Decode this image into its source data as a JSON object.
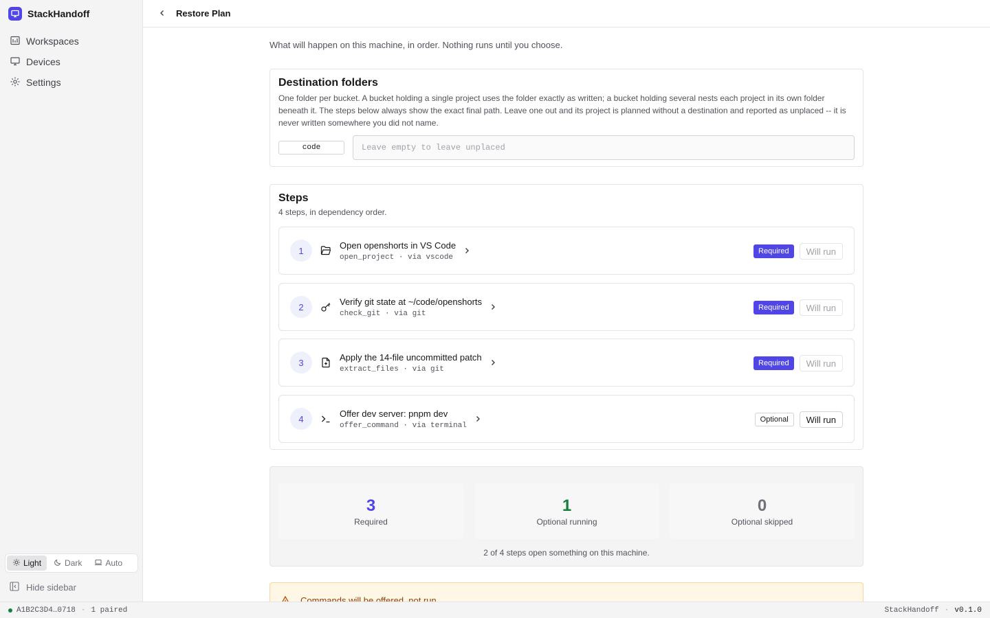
{
  "app": {
    "name": "StackHandoff",
    "version": "v0.1.0",
    "accent": "#4f46e5"
  },
  "sidebar": {
    "items": [
      {
        "label": "Workspaces",
        "icon": "workspaces-icon"
      },
      {
        "label": "Devices",
        "icon": "monitor-icon"
      },
      {
        "label": "Settings",
        "icon": "gear-icon"
      }
    ],
    "theme": {
      "options": [
        "Light",
        "Dark",
        "Auto"
      ],
      "selected": "Light"
    },
    "hide_label": "Hide sidebar"
  },
  "header": {
    "title": "Restore Plan"
  },
  "intro": "What will happen on this machine, in order. Nothing runs until you choose.",
  "destination": {
    "title": "Destination folders",
    "description": "One folder per bucket. A bucket holding a single project uses the folder exactly as written; a bucket holding several nests each project in its own folder beneath it. The steps below always show the exact final path. Leave one out and its project is planned without a destination and reported as unplaced -- it is never written somewhere you did not name.",
    "bucket": "code",
    "value": "",
    "placeholder": "Leave empty to leave unplaced"
  },
  "steps": {
    "title": "Steps",
    "subtitle": "4 steps, in dependency order.",
    "items": [
      {
        "number": "1",
        "icon": "folder-open-icon",
        "title": "Open openshorts in VS Code",
        "meta": "open_project · via vscode",
        "badge": "Required",
        "required": true,
        "action": "Will run"
      },
      {
        "number": "2",
        "icon": "key-icon",
        "title": "Verify git state at ~/code/openshorts",
        "meta": "check_git · via git",
        "badge": "Required",
        "required": true,
        "action": "Will run"
      },
      {
        "number": "3",
        "icon": "file-patch-icon",
        "title": "Apply the 14-file uncommitted patch",
        "meta": "extract_files · via git",
        "badge": "Required",
        "required": true,
        "action": "Will run"
      },
      {
        "number": "4",
        "icon": "terminal-icon",
        "title": "Offer dev server: pnpm dev",
        "meta": "offer_command · via terminal",
        "badge": "Optional",
        "required": false,
        "action": "Will run"
      }
    ]
  },
  "summary": {
    "stats": [
      {
        "value": "3",
        "label": "Required",
        "color": "#4f46e5"
      },
      {
        "value": "1",
        "label": "Optional running",
        "color": "#15803d"
      },
      {
        "value": "0",
        "label": "Optional skipped",
        "color": "#71717a"
      }
    ],
    "note": "2 of 4 steps open something on this machine."
  },
  "warning": {
    "text": "Commands will be offered, not run."
  },
  "statusbar": {
    "device_id": "A1B2C3D4…0718",
    "paired": "1 paired",
    "app_name": "StackHandoff",
    "version": "v0.1.0"
  }
}
